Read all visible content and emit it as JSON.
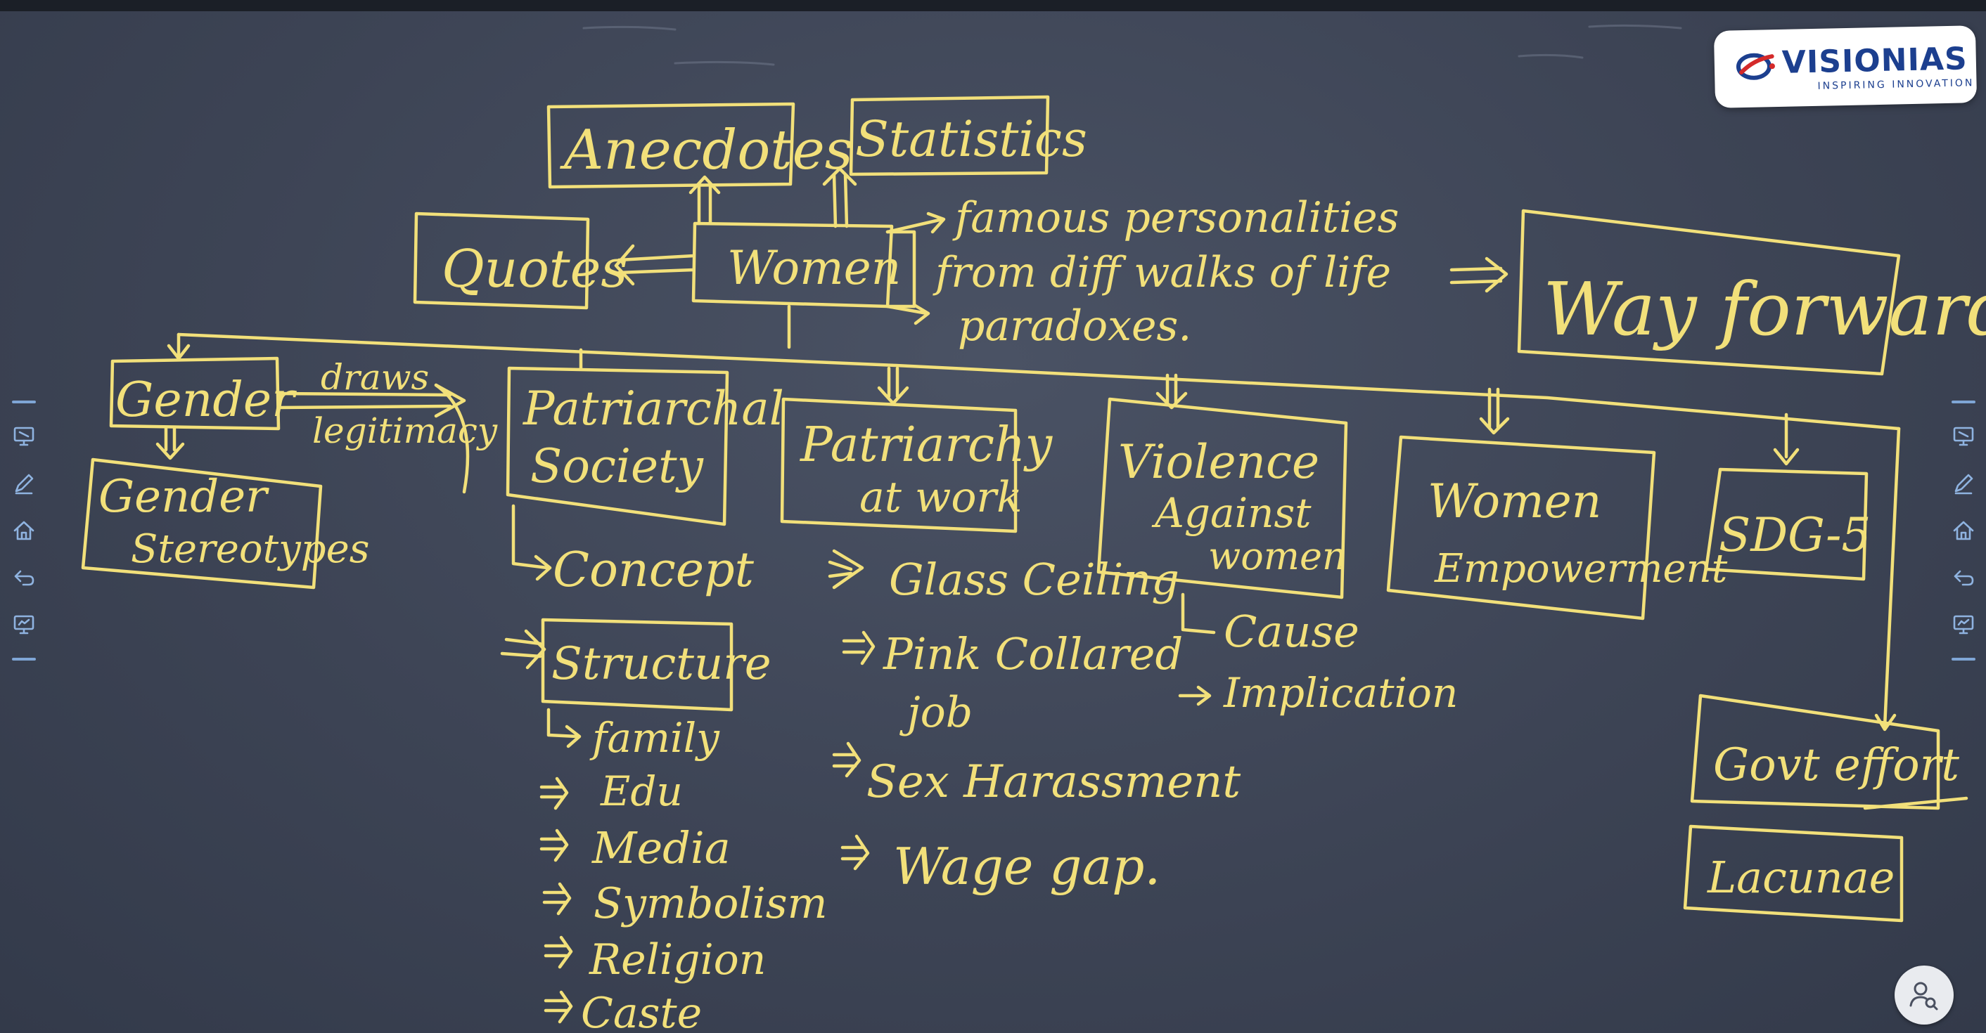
{
  "logo": {
    "name": "VISIONIAS",
    "tagline": "INSPIRING INNOVATION",
    "brand_color": "#1c3f8f"
  },
  "colors": {
    "board": "#3d4455",
    "chalk": "#f2e07a",
    "toolbar_icons": "#8fb3e0"
  },
  "diagram": {
    "center": "Women",
    "top_nodes": {
      "anecdotes": "Anecdotes",
      "statistics": "Statistics",
      "quotes": "Quotes"
    },
    "side_notes": {
      "line1": "famous personalities",
      "line2": "from diff walks of life",
      "line3": "paradoxes."
    },
    "way_forward": "Way forward",
    "gender": {
      "label": "Gender",
      "edge_label_1": "draws",
      "edge_label_2": "legitimacy",
      "stereotypes_line1": "Gender",
      "stereotypes_line2": "Stereotypes"
    },
    "patriarchal_society": {
      "line1": "Patriarchal",
      "line2": "Society",
      "concept": "Concept",
      "structure": "Structure",
      "structure_items": [
        "family",
        "Edu",
        "Media",
        "Symbolism",
        "Religion",
        "Caste"
      ]
    },
    "patriarchy_at_work": {
      "line1": "Patriarchy",
      "line2": "at work",
      "items": [
        "Glass Ceiling",
        "Pink Collared",
        "job",
        "Sex Harassment",
        "Wage gap."
      ]
    },
    "violence": {
      "line1": "Violence",
      "line2": "Against",
      "line3": "women",
      "items": [
        "Cause",
        "Implication"
      ]
    },
    "empowerment": {
      "line1": "Women",
      "line2": "Empowerment"
    },
    "sdg": "SDG-5",
    "govt_effort": "Govt effort",
    "lacunae": "Lacunae"
  },
  "toolbar_icons": [
    "screen-record-icon",
    "pen-icon",
    "home-icon",
    "undo-icon",
    "presentation-icon"
  ],
  "user_button_icon": "user-search-icon"
}
